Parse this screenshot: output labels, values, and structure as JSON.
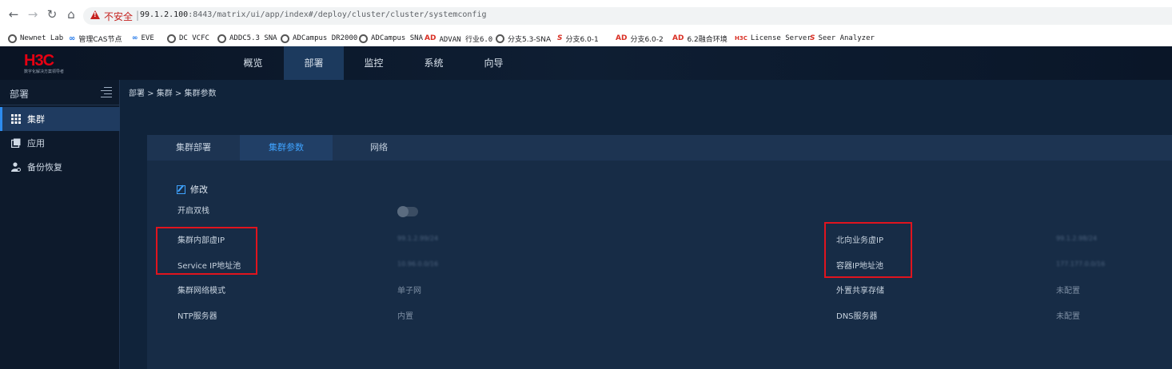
{
  "browser": {
    "insecure_label": "不安全",
    "url_host": "99.1.2.100",
    "url_path": ":8443/matrix/ui/app/index#/deploy/cluster/cluster/systemconfig",
    "bookmarks": [
      {
        "label": "Newnet Lab",
        "icon": "globe-icon"
      },
      {
        "label": "管理CAS节点",
        "icon": "cloud-icon"
      },
      {
        "label": "EVE",
        "icon": "eve-icon"
      },
      {
        "label": "DC VCFC",
        "icon": "globe-icon"
      },
      {
        "label": "ADDC5.3 SNA",
        "icon": "globe-icon"
      },
      {
        "label": "ADCampus DR2000",
        "icon": "globe-icon"
      },
      {
        "label": "ADCampus SNA",
        "icon": "globe-icon"
      },
      {
        "label": "ADVAN 行业6.0",
        "icon": "ad-icon"
      },
      {
        "label": "分支5.3-SNA",
        "icon": "globe-icon"
      },
      {
        "label": "分支6.0-1",
        "icon": "s-icon"
      },
      {
        "label": "分支6.0-2",
        "icon": "ad-icon"
      },
      {
        "label": "6.2融合环境",
        "icon": "ad-icon"
      },
      {
        "label": "License Server",
        "icon": "h3c-icon"
      },
      {
        "label": "Seer Analyzer",
        "icon": "s-icon"
      }
    ]
  },
  "app": {
    "logo": "H3C",
    "logo_sub": "数字化解决方案领导者",
    "menu": [
      "概览",
      "部署",
      "监控",
      "系统",
      "向导"
    ],
    "active_menu": "部署",
    "sidebar": {
      "title": "部署",
      "items": [
        {
          "label": "集群",
          "icon": "grid-icon",
          "active": true
        },
        {
          "label": "应用",
          "icon": "app-icon",
          "active": false
        },
        {
          "label": "备份恢复",
          "icon": "user-gear-icon",
          "active": false
        }
      ]
    },
    "breadcrumb": "部署 > 集群 > 集群参数",
    "tabs": [
      "集群部署",
      "集群参数",
      "网络"
    ],
    "active_tab": "集群参数",
    "edit_label": "修改",
    "params": {
      "dual_stack_label": "开启双栈",
      "dual_stack_on": false,
      "internal_vip_label": "集群内部虚IP",
      "internal_vip_value": "99.1.2.99/24",
      "service_ip_label": "Service IP地址池",
      "service_ip_value": "10.96.0.0/16",
      "north_vip_label": "北向业务虚IP",
      "north_vip_value": "99.1.2.98/24",
      "container_ip_label": "容器IP地址池",
      "container_ip_value": "177.177.0.0/16",
      "network_mode_label": "集群网络模式",
      "network_mode_value": "单子网",
      "shared_storage_label": "外置共享存储",
      "shared_storage_value": "未配置",
      "ntp_label": "NTP服务器",
      "ntp_value": "内置",
      "dns_label": "DNS服务器",
      "dns_value": "未配置"
    }
  },
  "colors": {
    "accent": "#3fa3ff",
    "highlight_box": "#e0141e",
    "app_bg": "#10233a"
  }
}
